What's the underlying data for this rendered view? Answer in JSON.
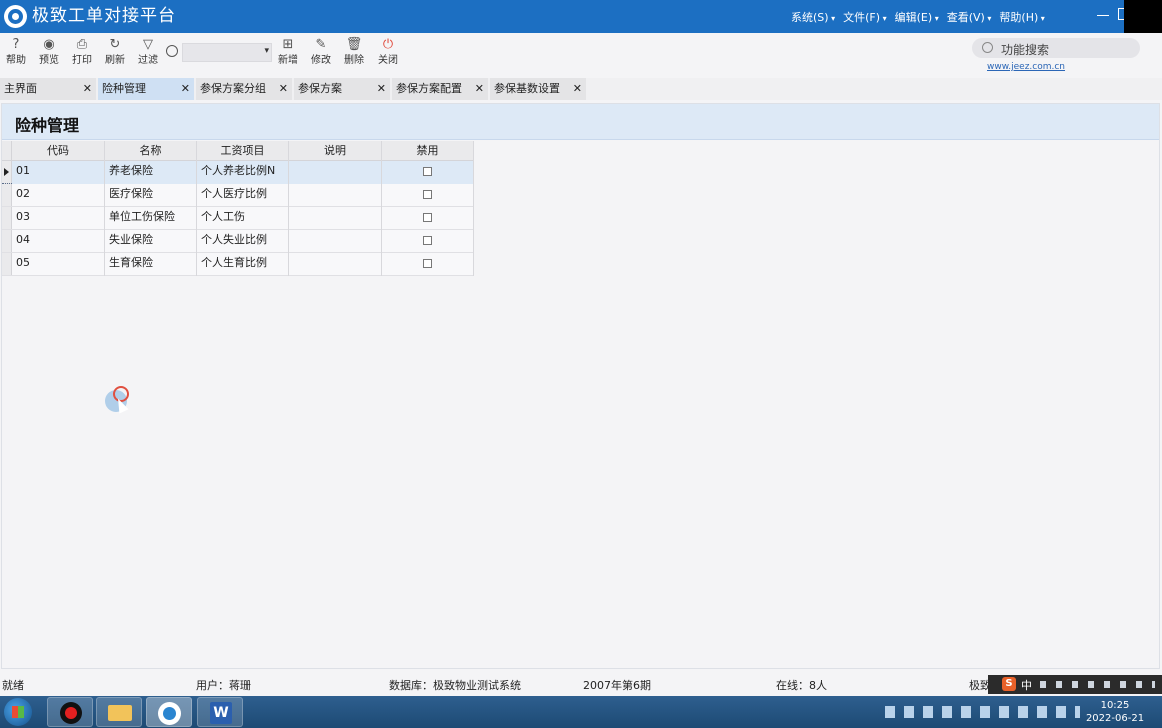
{
  "app": {
    "title": "极致工单对接平台"
  },
  "menu": [
    "系统(S)",
    "文件(F)",
    "编辑(E)",
    "查看(V)",
    "帮助(H)"
  ],
  "toolbar": {
    "help": "帮助",
    "preview": "预览",
    "print": "打印",
    "refresh": "刷新",
    "filter": "过滤",
    "new": "新增",
    "edit": "修改",
    "delete": "删除",
    "close": "关闭",
    "function_search": "功能搜索",
    "site_link": "www.jeez.com.cn"
  },
  "tabs": [
    "主界面",
    "险种管理",
    "参保方案分组",
    "参保方案",
    "参保方案配置",
    "参保基数设置"
  ],
  "active_tab": "险种管理",
  "page": {
    "title": "险种管理"
  },
  "grid": {
    "columns": [
      "代码",
      "名称",
      "工资项目",
      "说明",
      "禁用"
    ],
    "rows": [
      {
        "code": "01",
        "name": "养老保险",
        "salary_item": "个人养老比例N",
        "note": "",
        "disabled": false
      },
      {
        "code": "02",
        "name": "医疗保险",
        "salary_item": "个人医疗比例",
        "note": "",
        "disabled": false
      },
      {
        "code": "03",
        "name": "单位工伤保险",
        "salary_item": "个人工伤",
        "note": "",
        "disabled": false
      },
      {
        "code": "04",
        "name": "失业保险",
        "salary_item": "个人失业比例",
        "note": "",
        "disabled": false
      },
      {
        "code": "05",
        "name": "生育保险",
        "salary_item": "个人生育比例",
        "note": "",
        "disabled": false
      }
    ],
    "selected_row": 0
  },
  "status": {
    "state": "就绪",
    "user": "用户：蒋珊",
    "database": "数据库：极致物业测试系统",
    "period": "2007年第6期",
    "online": "在线：8人",
    "company": "极致"
  },
  "ime": {
    "logo": "S",
    "mode": "中"
  },
  "clock": {
    "time": "10:25",
    "date": "2022-06-21"
  },
  "taskbar": {
    "word_letter": "W"
  }
}
